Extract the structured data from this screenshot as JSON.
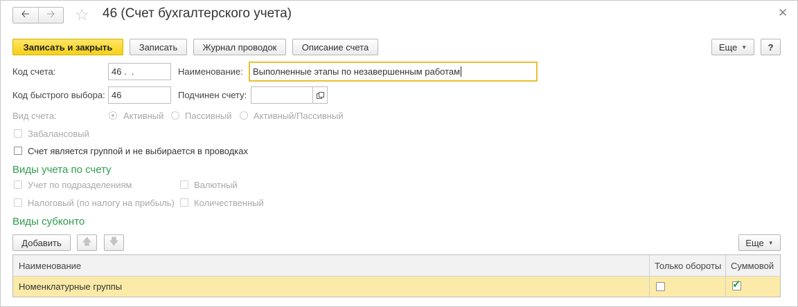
{
  "window": {
    "title": "46 (Счет бухгалтерского учета)"
  },
  "toolbar": {
    "save_close_label": "Записать и закрыть",
    "save_label": "Записать",
    "journal_label": "Журнал проводок",
    "description_label": "Описание счета",
    "more_label": "Еще",
    "help_label": "?"
  },
  "form": {
    "code_label": "Код счета:",
    "code_value": "46 .  .",
    "name_label": "Наименование:",
    "name_value": "Выполненные этапы по незавершенным работам",
    "quick_code_label": "Код быстрого выбора:",
    "quick_code_value": "46",
    "parent_label": "Подчинен счету:",
    "parent_value": "",
    "type_label": "Вид счета:",
    "type_options": [
      "Активный",
      "Пассивный",
      "Активный/Пассивный"
    ],
    "type_selected": "Активный",
    "offbalance_label": "Забалансовый",
    "is_group_label": "Счет является группой и не выбирается в проводках"
  },
  "accounting": {
    "section_title": "Виды учета по счету",
    "by_department": "Учет по подразделениям",
    "currency": "Валютный",
    "tax": "Налоговый (по налогу на прибыль)",
    "quantity": "Количественный"
  },
  "subconto": {
    "section_title": "Виды субконто",
    "add_label": "Добавить",
    "more_label": "Еще",
    "columns": {
      "name": "Наименование",
      "turnover_only": "Только обороты",
      "sum": "Суммовой"
    },
    "rows": [
      {
        "name": "Номенклатурные группы",
        "turnover_only": false,
        "sum": true
      }
    ]
  },
  "colors": {
    "primary_button": "#f5d116",
    "section_title": "#2f9b4c",
    "selected_row": "#fbeaa8",
    "check_mark": "#1a9a3a"
  }
}
